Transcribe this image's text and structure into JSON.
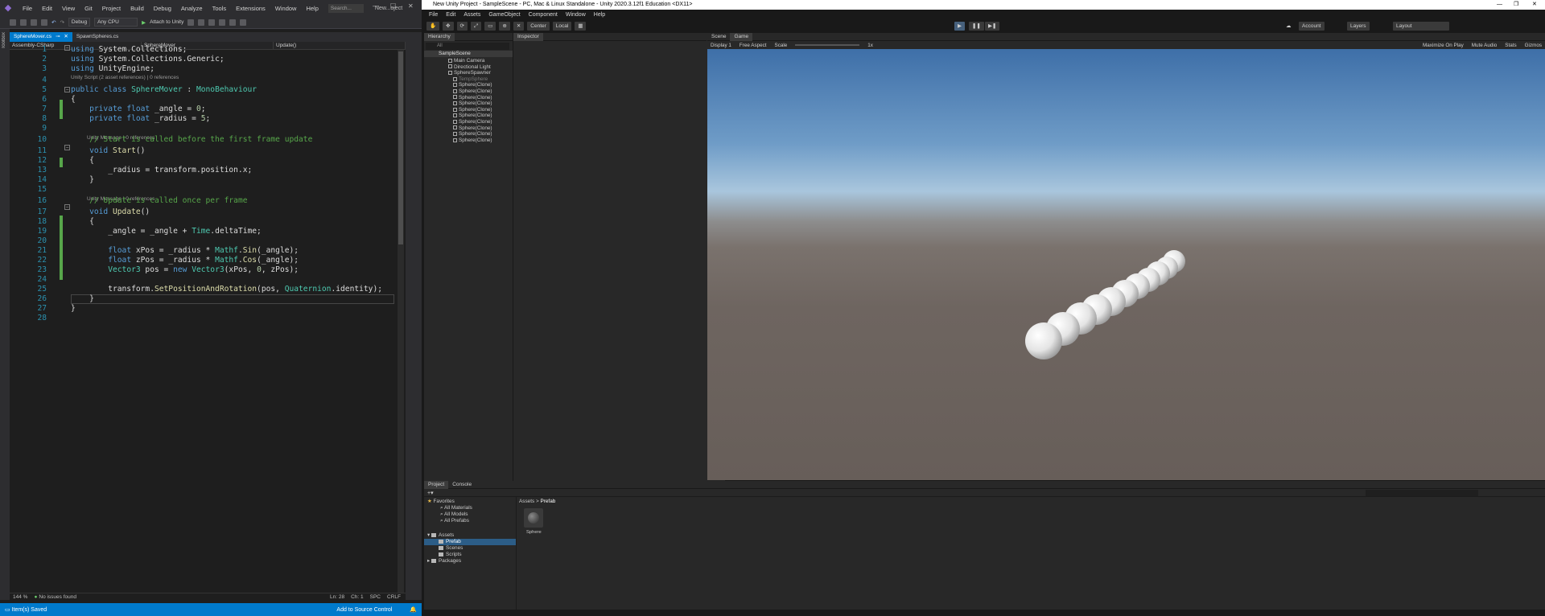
{
  "vs": {
    "menu": [
      "File",
      "Edit",
      "View",
      "Git",
      "Project",
      "Build",
      "Debug",
      "Analyze",
      "Tools",
      "Extensions",
      "Window",
      "Help"
    ],
    "search_placeholder": "Search...",
    "solution_name": "New...oject",
    "toolbar": {
      "config": "Debug",
      "platform": "Any CPU",
      "attach": "Attach to Unity"
    },
    "side_strip_label": "Toolbox",
    "tabs": [
      {
        "label": "SphereMover.cs",
        "active": true
      },
      {
        "label": "SpawnSpheres.cs",
        "active": false
      }
    ],
    "nav": [
      "Assembly-CSharp",
      "SphereMover",
      "Update()"
    ],
    "code_lines": [
      {
        "n": "1",
        "html": "<span class='kw'>using</span> System.Collections;"
      },
      {
        "n": "2",
        "html": "<span class='kw'>using</span> System.Collections.Generic;"
      },
      {
        "n": "3",
        "html": "<span class='kw'>using</span> UnityEngine;"
      },
      {
        "n": "4",
        "html": ""
      },
      {
        "n": "5",
        "html": "<span class='kw'>public class</span> <span class='ty'>SphereMover</span> : <span class='ty'>MonoBehaviour</span>"
      },
      {
        "n": "6",
        "html": "{"
      },
      {
        "n": "7",
        "html": "    <span class='kw'>private float</span> _angle = <span class='nm'>0</span>;"
      },
      {
        "n": "8",
        "html": "    <span class='kw'>private float</span> _radius = <span class='nm'>5</span>;"
      },
      {
        "n": "9",
        "html": ""
      },
      {
        "n": "10",
        "html": "    <span class='cm'>// Start is called before the first frame update</span>"
      },
      {
        "n": "11",
        "html": "    <span class='kw'>void</span> <span class='mt'>Start</span>()"
      },
      {
        "n": "12",
        "html": "    {"
      },
      {
        "n": "13",
        "html": "        _radius = transform.position.x;"
      },
      {
        "n": "14",
        "html": "    }"
      },
      {
        "n": "15",
        "html": ""
      },
      {
        "n": "16",
        "html": "    <span class='cm'>// Update is called once per frame</span>"
      },
      {
        "n": "17",
        "html": "    <span class='kw'>void</span> <span class='mt'>Update</span>()"
      },
      {
        "n": "18",
        "html": "    {"
      },
      {
        "n": "19",
        "html": "        _angle = _angle + <span class='ty'>Time</span>.deltaTime;"
      },
      {
        "n": "20",
        "html": ""
      },
      {
        "n": "21",
        "html": "        <span class='kw'>float</span> xPos = _radius * <span class='ty'>Mathf</span>.<span class='mt'>Sin</span>(_angle);"
      },
      {
        "n": "22",
        "html": "        <span class='kw'>float</span> zPos = _radius * <span class='ty'>Mathf</span>.<span class='mt'>Cos</span>(_angle);"
      },
      {
        "n": "23",
        "html": "        <span class='ty'>Vector3</span> pos = <span class='kw'>new</span> <span class='ty'>Vector3</span>(xPos, <span class='nm'>0</span>, zPos);"
      },
      {
        "n": "24",
        "html": ""
      },
      {
        "n": "25",
        "html": "        transform.<span class='mt'>SetPositionAndRotation</span>(pos, <span class='ty'>Quaternion</span>.identity);"
      },
      {
        "n": "26",
        "html": "    }"
      },
      {
        "n": "27",
        "html": "}"
      },
      {
        "n": "28",
        "html": ""
      }
    ],
    "lens_class": "Unity Script (2 asset references) | 0 references",
    "lens_start": "Unity Message | 0 references",
    "lens_update": "Unity Message | 0 references",
    "status2": {
      "zoom": "144 %",
      "issues": "No issues found",
      "ln": "Ln: 28",
      "ch": "Ch: 1",
      "spc": "SPC",
      "crlf": "CRLF"
    },
    "status": {
      "left": "Item(s) Saved",
      "right": "Add to Source Control"
    }
  },
  "unity": {
    "title": "New Unity Project - SampleScene - PC, Mac & Linux Standalone - Unity 2020.3.12f1 Education <DX11>",
    "menu": [
      "File",
      "Edit",
      "Assets",
      "GameObject",
      "Component",
      "Window",
      "Help"
    ],
    "toolbar": {
      "center": "Center",
      "local": "Local",
      "account": "Account",
      "layers": "Layers",
      "layout": "Layout"
    },
    "hierarchy_tab": "Hierarchy",
    "hierarchy_search": "All",
    "scene_name": "SampleScene",
    "hierarchy_items": [
      "Main Camera",
      "Directional Light",
      "SphereSpawner",
      "TempSphere",
      "Sphere(Clone)",
      "Sphere(Clone)",
      "Sphere(Clone)",
      "Sphere(Clone)",
      "Sphere(Clone)",
      "Sphere(Clone)",
      "Sphere(Clone)",
      "Sphere(Clone)",
      "Sphere(Clone)",
      "Sphere(Clone)"
    ],
    "inspector_tab": "Inspector",
    "scene_tab": "Scene",
    "game_tab": "Game",
    "game_bar": {
      "display": "Display 1",
      "aspect": "Free Aspect",
      "scale_label": "Scale",
      "scale_value": "1x",
      "right": [
        "Maximize On Play",
        "Mute Audio",
        "Stats",
        "Gizmos"
      ]
    },
    "project_tab": "Project",
    "console_tab": "Console",
    "favorites": {
      "label": "Favorites",
      "items": [
        "All Materials",
        "All Models",
        "All Prefabs"
      ]
    },
    "assets": {
      "label": "Assets",
      "items": [
        "Prefab",
        "Scenes",
        "Scripts"
      ]
    },
    "packages_label": "Packages",
    "breadcrumb": [
      "Assets",
      "Prefab"
    ],
    "asset_item": "Sphere"
  }
}
